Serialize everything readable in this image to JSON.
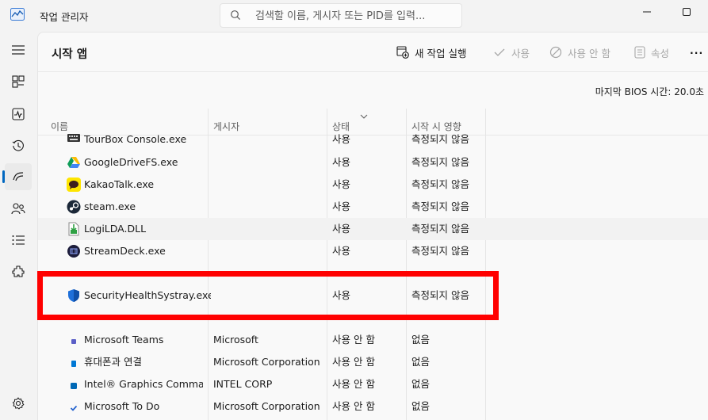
{
  "window": {
    "title": "작업 관리자",
    "search_placeholder": "검색할 이름, 게시자 또는 PID를 입력..."
  },
  "nav": {
    "items": [
      {
        "icon": "hamburger-icon"
      },
      {
        "icon": "processes-icon"
      },
      {
        "icon": "performance-icon"
      },
      {
        "icon": "app-history-icon"
      },
      {
        "icon": "startup-apps-icon",
        "active": true
      },
      {
        "icon": "users-icon"
      },
      {
        "icon": "details-icon"
      },
      {
        "icon": "services-icon"
      },
      {
        "icon": "settings-icon"
      }
    ]
  },
  "page": {
    "title": "시작 앱",
    "bios_label": "마지막 BIOS 시간:",
    "bios_value": "20.0초"
  },
  "toolbar": {
    "new_task": "새 작업 실행",
    "enable": "사용",
    "disable": "사용 안 함",
    "properties": "속성",
    "more": "···"
  },
  "table": {
    "columns": [
      "이름",
      "게시자",
      "상태",
      "시작 시 영향"
    ],
    "rows": [
      {
        "name": "TourBox Console.exe",
        "publisher": "",
        "status": "사용",
        "impact": "측정되지 않음"
      },
      {
        "name": "GoogleDriveFS.exe",
        "publisher": "",
        "status": "사용",
        "impact": "측정되지 않음"
      },
      {
        "name": "KakaoTalk.exe",
        "publisher": "",
        "status": "사용",
        "impact": "측정되지 않음"
      },
      {
        "name": "steam.exe",
        "publisher": "",
        "status": "사용",
        "impact": "측정되지 않음"
      },
      {
        "name": "LogiLDA.DLL",
        "publisher": "",
        "status": "사용",
        "impact": "측정되지 않음"
      },
      {
        "name": "StreamDeck.exe",
        "publisher": "",
        "status": "사용",
        "impact": "측정되지 않음"
      },
      {
        "name": "",
        "publisher": "",
        "status": "",
        "impact": ""
      },
      {
        "name": "SecurityHealthSystray.exe",
        "publisher": "",
        "status": "사용",
        "impact": "측정되지 않음"
      },
      {
        "name": "",
        "publisher": "",
        "status": "",
        "impact": ""
      },
      {
        "name": "Microsoft Teams",
        "publisher": "Microsoft",
        "status": "사용 안 함",
        "impact": "없음"
      },
      {
        "name": "휴대폰과 연결",
        "publisher": "Microsoft Corporation",
        "status": "사용 안 함",
        "impact": "없음"
      },
      {
        "name": "Intel® Graphics Comman...",
        "publisher": "INTEL CORP",
        "status": "사용 안 함",
        "impact": "없음"
      },
      {
        "name": "Microsoft To Do",
        "publisher": "Microsoft Corporation",
        "status": "사용 안 함",
        "impact": "없음"
      }
    ]
  },
  "colors": {
    "accent": "#0067c0",
    "highlight": "#ff0000"
  }
}
